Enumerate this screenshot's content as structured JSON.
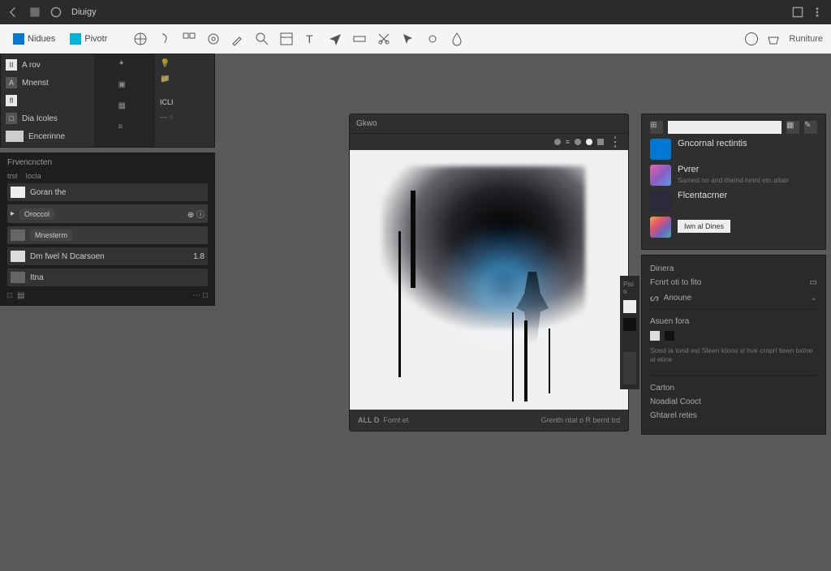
{
  "titlebar": {
    "app": "Diuigy"
  },
  "toolbar": {
    "tabs": [
      {
        "label": "Nidues"
      },
      {
        "label": "Pivotr"
      }
    ],
    "right_label": "Runiture"
  },
  "left": {
    "rows": [
      {
        "label": "A rov"
      },
      {
        "label": "Mnenst"
      },
      {
        "label": ""
      },
      {
        "label": "Dia Icoles"
      },
      {
        "label": "Encerinne"
      }
    ],
    "col3_label": "ICLI",
    "panel_b_title": "Frvencncten",
    "tabs": [
      "trst",
      "Iocla"
    ],
    "layers": [
      {
        "name": "Goran the"
      },
      {
        "name": "Oroccol"
      },
      {
        "name": "Mnesterm"
      },
      {
        "name": "Dm fwel N Dcarsoen"
      },
      {
        "name": "Itna"
      }
    ],
    "value": "1.8"
  },
  "canvas": {
    "title": "Gkwo",
    "foot_left": "ALL D",
    "foot_mid": "Fornt et",
    "foot_right": "Grenth ntat o R bernt trd"
  },
  "right": {
    "search_placeholder": "",
    "header": "Gncornal rectintis",
    "presets": [
      {
        "title": "Pvrer",
        "sub": "Samed no and theind heint etn altatr"
      },
      {
        "title": "Flcentacrner"
      }
    ],
    "button": "Iwn al Dines",
    "props": {
      "sec1": "Dinera",
      "row1": "Fcnrt oti to fito",
      "row2": "Anoune",
      "row3_label": "Asuen fora",
      "note": "Soed ia tond est Sleen ktons sl hve crnprl tleen bxtne al etine",
      "sec2": "Carton",
      "sec2_a": "Noadial Cooct",
      "sec2_b": "Ghtarel retes"
    },
    "strip_label": "Pisi o"
  }
}
